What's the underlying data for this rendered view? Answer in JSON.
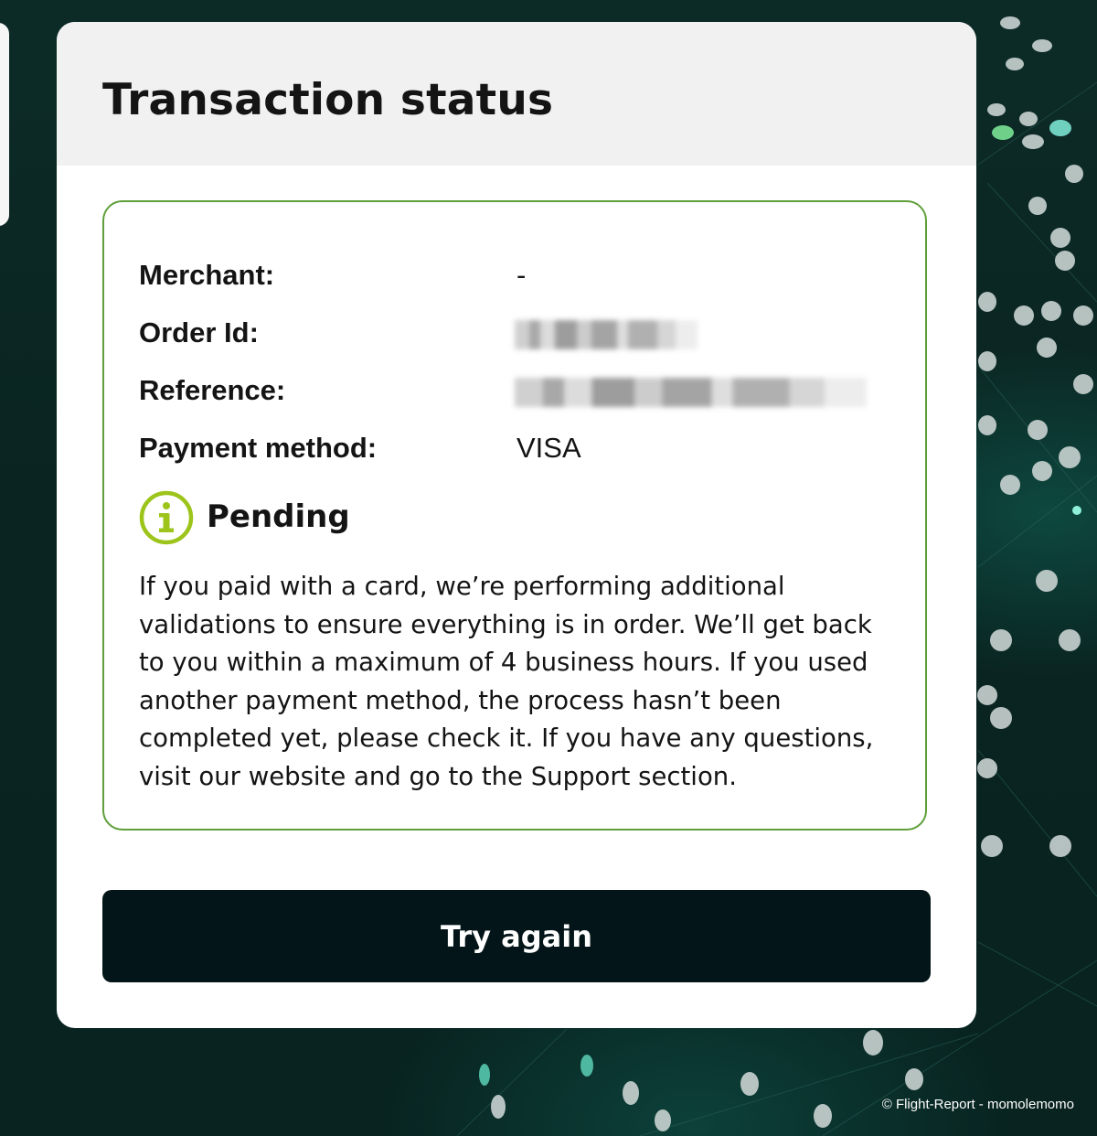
{
  "page": {
    "title": "Transaction status"
  },
  "details": {
    "merchant": {
      "label": "Merchant:",
      "value": "-"
    },
    "order_id": {
      "label": "Order Id:",
      "value": ""
    },
    "reference": {
      "label": "Reference:",
      "value": ""
    },
    "payment_method": {
      "label": "Payment method:",
      "value": "VISA"
    }
  },
  "status": {
    "icon": "info-icon",
    "label": "Pending",
    "message": "If you paid with a card, we’re performing additional validations to ensure everything is in order. We’ll get back to you within a maximum of 4 business hours. If you used another payment method, the process hasn’t been completed yet, please check it. If you have any questions, visit our website and go to the Support section."
  },
  "actions": {
    "try_again_label": "Try again"
  },
  "watermark": "© Flight-Report - momolemomo",
  "colors": {
    "box_border": "#5f9f3a",
    "info_icon": "#9cc41a",
    "button_bg": "#031518",
    "background": "#0a2421"
  }
}
